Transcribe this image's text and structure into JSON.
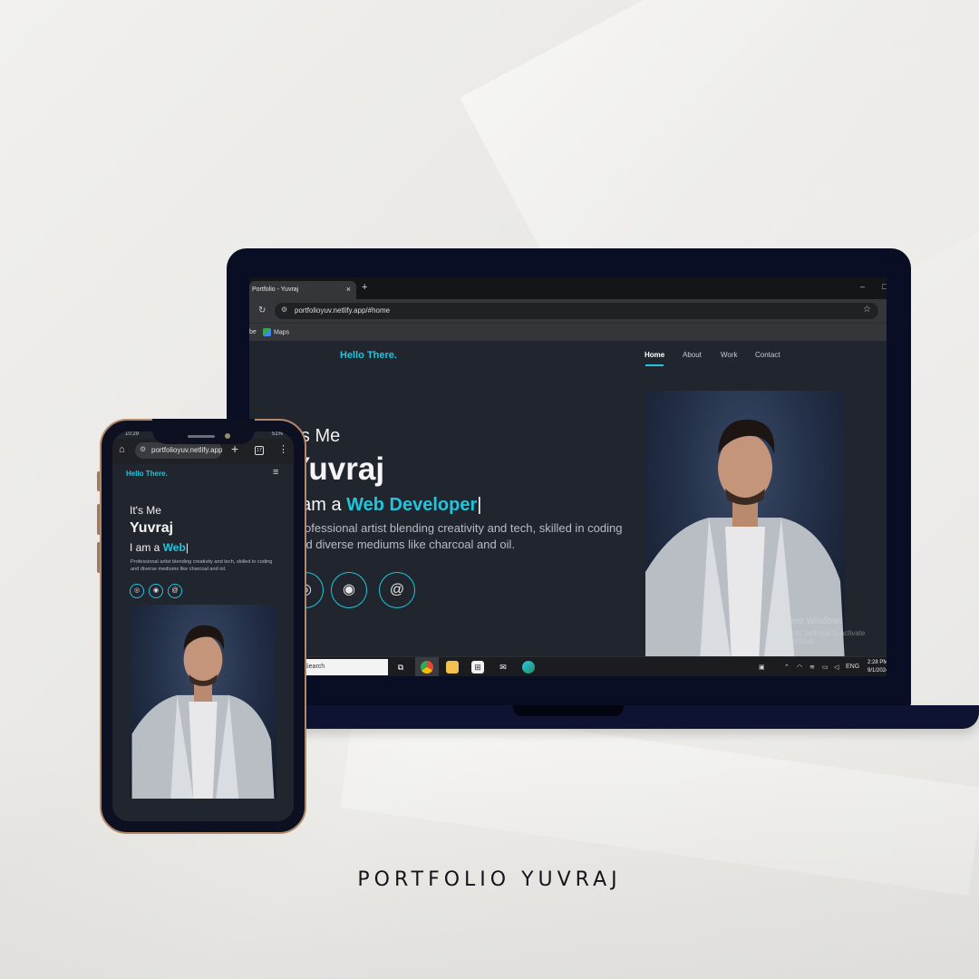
{
  "caption": "PORTFOLIO YUVRAJ",
  "colors": {
    "accent": "#1fc6dd",
    "site_bg": "#21252e",
    "device_frame": "#0a0e24"
  },
  "laptop": {
    "browser": {
      "tab_title": "Portfolio - Yuvraj",
      "tab_close": "×",
      "new_tab": "+",
      "minimize": "–",
      "url": "portfolioyuv.netlify.app/#home",
      "bookmark_partial": "be",
      "bookmark_maps": "Maps"
    },
    "site": {
      "logo": "Hello There.",
      "nav": [
        "Home",
        "About",
        "Work",
        "Contact"
      ],
      "intro": "It's Me",
      "name": "Yuvraj",
      "role_prefix": "I am a ",
      "role_accent": "Web Developer",
      "cursor": "|",
      "description": "Professional artist blending creativity and tech, skilled in coding and diverse mediums like charcoal and oil.",
      "social_icons": [
        "instagram-icon",
        "github-icon",
        "threads-icon"
      ],
      "social_glyphs": [
        "◎",
        "◉",
        "@"
      ]
    },
    "watermark": {
      "line1": "Activate Windows",
      "line2": "Go to Settings to activate Windows."
    },
    "taskbar": {
      "search": "Search",
      "tray_lang": "ENG",
      "time": "2:28 PM",
      "date": "9/1/2024"
    }
  },
  "phone": {
    "status_time": "10:29",
    "status_battery": "51%",
    "url": "portfolioyuv.netlify.app",
    "tab_count": "17",
    "site": {
      "logo": "Hello There.",
      "intro": "It's Me",
      "name": "Yuvraj",
      "role_prefix": "I am a ",
      "role_accent": "Web",
      "cursor": "|",
      "description": "Professional artist blending creativity and tech, skilled in coding and diverse mediums like charcoal and oil.",
      "social_icons": [
        "instagram-icon",
        "github-icon",
        "threads-icon"
      ],
      "social_glyphs": [
        "◎",
        "◉",
        "@"
      ]
    }
  }
}
